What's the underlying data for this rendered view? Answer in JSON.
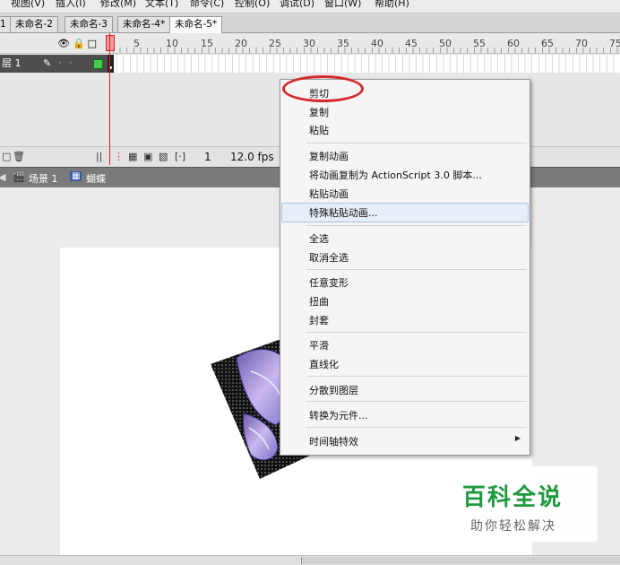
{
  "menubar": {
    "items": [
      "视图(V)",
      "插入(I)",
      "修改(M)",
      "文本(T)",
      "命令(C)",
      "控制(O)",
      "调试(D)",
      "窗口(W)",
      "帮助(H)"
    ]
  },
  "tabs": [
    "1",
    "未命名-2",
    "未命名-3",
    "未命名-4*",
    "未命名-5*"
  ],
  "timeline": {
    "ruler": [
      "1",
      "5",
      "10",
      "15",
      "20",
      "25",
      "30",
      "35",
      "40",
      "45",
      "50",
      "55",
      "60",
      "65",
      "70",
      "75"
    ],
    "layer_name": "层 1",
    "current_frame": "1",
    "fps": "12.0 fps"
  },
  "editbar": {
    "scene": "场景 1",
    "symbol": "蝴蝶"
  },
  "context_menu": {
    "items": [
      "剪切",
      "复制",
      "粘贴",
      "复制动画",
      "将动画复制为 ActionScript 3.0 脚本...",
      "粘贴动画",
      "特殊粘贴动画...",
      "全选",
      "取消全选",
      "任意变形",
      "扭曲",
      "封套",
      "平滑",
      "直线化",
      "分散到图层",
      "转换为元件...",
      "时间轴特效"
    ],
    "highlighted": "特殊粘贴动画...",
    "annotation_color": "#d42a2a"
  },
  "watermark": {
    "title": "百科全说",
    "subtitle": "助你轻松解决"
  },
  "colors": {
    "accent_green": "#1e9a3e",
    "timeline_layer": "#4e4e4e",
    "playhead": "#dd2222"
  }
}
